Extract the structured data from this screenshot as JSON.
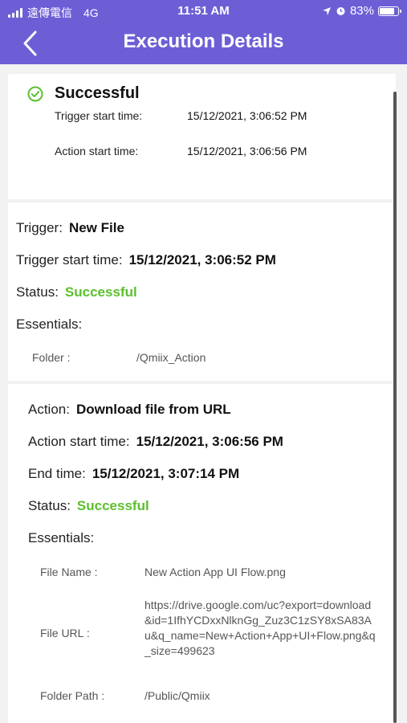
{
  "status_bar": {
    "carrier": "遠傳電信",
    "network": "4G",
    "time": "11:51 AM",
    "battery": "83%",
    "battery_level": 0.83
  },
  "nav": {
    "title": "Execution Details"
  },
  "summary": {
    "status": "Successful",
    "trigger_start_label": "Trigger start time:",
    "trigger_start_value": "15/12/2021, 3:06:52 PM",
    "action_start_label": "Action start time:",
    "action_start_value": "15/12/2021, 3:06:56 PM"
  },
  "trigger": {
    "trigger_label": "Trigger:",
    "trigger_value": "New File",
    "start_label": "Trigger start time:",
    "start_value": "15/12/2021, 3:06:52 PM",
    "status_label": "Status:",
    "status_value": "Successful",
    "essentials_label": "Essentials:",
    "folder_label": "Folder :",
    "folder_value": "/Qmiix_Action"
  },
  "action": {
    "action_label": "Action:",
    "action_value": "Download file from URL",
    "start_label": "Action start time:",
    "start_value": "15/12/2021, 3:06:56 PM",
    "end_label": "End time:",
    "end_value": "15/12/2021, 3:07:14 PM",
    "status_label": "Status:",
    "status_value": "Successful",
    "essentials_label": "Essentials:",
    "file_name_label": "File Name :",
    "file_name_value": "New Action App UI Flow.png",
    "file_url_label": "File URL :",
    "file_url_value": "https://drive.google.com/uc?export=download&id=1IfhYCDxxNlknGg_Zuz3C1zSY8xSA83Au&q_name=New+Action+App+UI+Flow.png&q_size=499623",
    "folder_path_label": "Folder Path :",
    "folder_path_value": "/Public/Qmiix"
  },
  "colors": {
    "header": "#6c5fd6",
    "success": "#5bbf2e"
  },
  "icons": {
    "back": "chevron-left-icon",
    "success": "check-circle-icon"
  }
}
